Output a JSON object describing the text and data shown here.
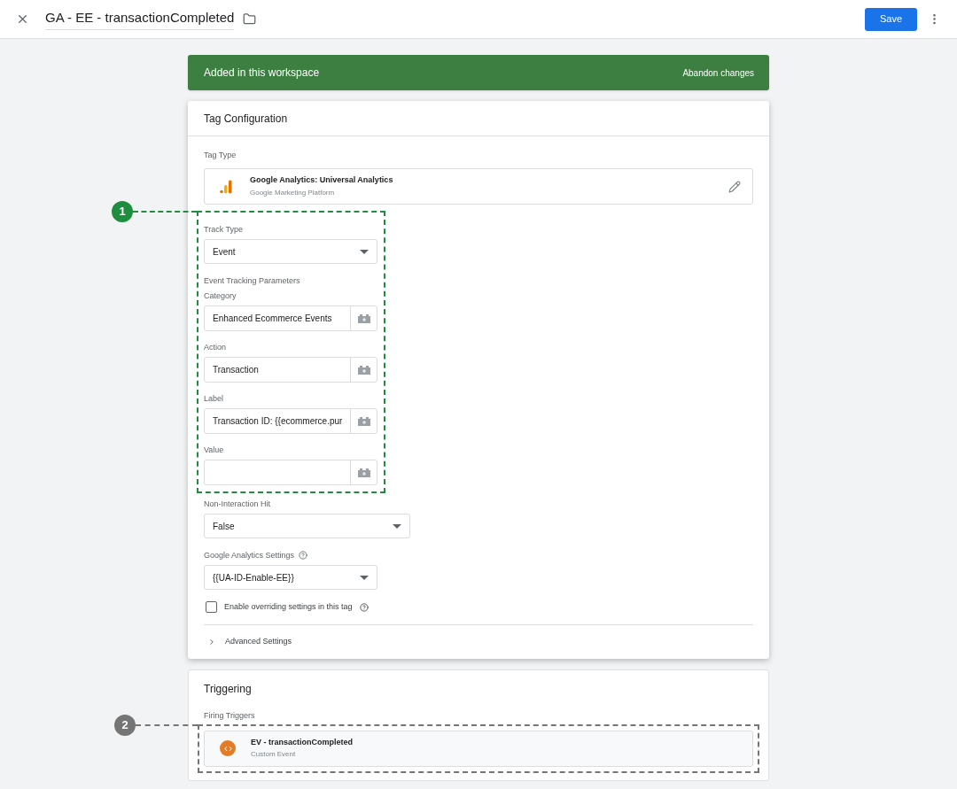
{
  "header": {
    "title": "GA - EE - transactionCompleted",
    "save": "Save"
  },
  "banner": {
    "message": "Added in this workspace",
    "action": "Abandon changes"
  },
  "tag_configuration": {
    "title": "Tag Configuration",
    "tag_type_label": "Tag Type",
    "tag_type": {
      "name": "Google Analytics: Universal Analytics",
      "provider": "Google Marketing Platform"
    },
    "track_type": {
      "label": "Track Type",
      "value": "Event"
    },
    "parameters_heading": "Event Tracking Parameters",
    "parameters": [
      {
        "label": "Category",
        "value": "Enhanced Ecommerce Events"
      },
      {
        "label": "Action",
        "value": "Transaction"
      },
      {
        "label": "Label",
        "value": "Transaction ID: {{ecommerce.pur"
      },
      {
        "label": "Value"
      }
    ],
    "non_interaction": {
      "label": "Non-Interaction Hit",
      "value": "False"
    },
    "ga_settings": {
      "label": "Google Analytics Settings",
      "value": "{{UA-ID-Enable-EE}}"
    },
    "override": {
      "label": "Enable overriding settings in this tag",
      "checked": false
    },
    "advanced": {
      "label": "Advanced Settings",
      "expanded": false
    }
  },
  "triggering": {
    "title": "Triggering",
    "firing_label": "Firing Triggers",
    "triggers": [
      {
        "name": "EV - transactionCompleted",
        "type": "Custom Event"
      }
    ]
  },
  "callouts": [
    {
      "number": "1",
      "color": "#1e8e3e"
    },
    {
      "number": "2",
      "color": "#757575"
    }
  ]
}
